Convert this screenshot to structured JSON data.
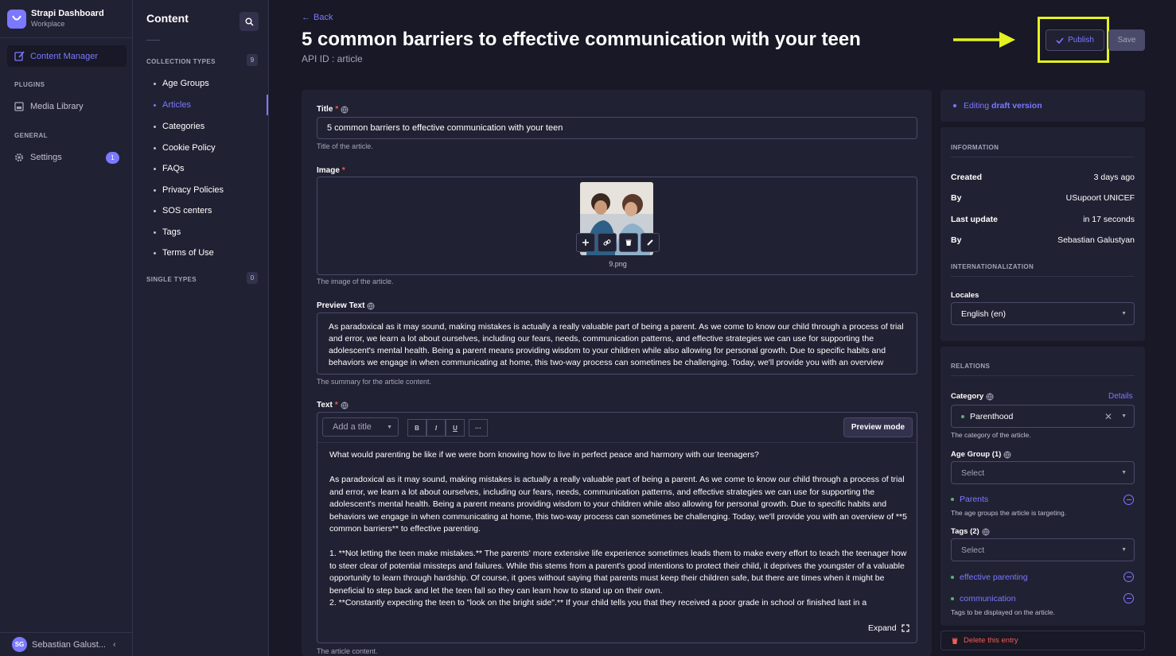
{
  "brand": {
    "name": "Strapi Dashboard",
    "sub": "Workplace"
  },
  "nav": {
    "content_manager": "Content Manager",
    "plugins_label": "PLUGINS",
    "media_library": "Media Library",
    "general_label": "GENERAL",
    "settings": "Settings",
    "settings_badge": "1",
    "user_initials": "SG",
    "user_name": "Sebastian Galust..."
  },
  "subnav": {
    "title": "Content",
    "collection_label": "COLLECTION TYPES",
    "collection_count": "9",
    "items": [
      "Age Groups",
      "Articles",
      "Categories",
      "Cookie Policy",
      "FAQs",
      "Privacy Policies",
      "SOS centers",
      "Tags",
      "Terms of Use"
    ],
    "active_item": "Articles",
    "single_label": "SINGLE TYPES",
    "single_count": "0"
  },
  "header": {
    "back": "Back",
    "title": "5 common barriers to effective communication with your teen",
    "api_id": "API ID : article",
    "publish": "Publish",
    "save": "Save"
  },
  "form": {
    "title_label": "Title",
    "title_value": "5 common barriers to effective communication with your teen",
    "title_hint": "Title of the article.",
    "image_label": "Image",
    "image_name": "9.png",
    "image_hint": "The image of the article.",
    "preview_label": "Preview Text",
    "preview_value": "As paradoxical as it may sound, making mistakes is actually a really valuable part of being a parent. As we come to know our child through a process of trial and error, we learn a lot about ourselves, including our fears, needs, communication patterns, and effective strategies we can use for supporting the adolescent's mental health. Being a parent means providing wisdom to your children while also allowing for personal growth. Due to specific habits and behaviors we engage in when communicating at home, this two-way process can sometimes be challenging. Today, we'll provide you with an overview",
    "preview_hint": "The summary for the article content.",
    "text_label": "Text",
    "toolbar_select": "Add a title",
    "toolbar_bold": "B",
    "toolbar_italic": "I",
    "toolbar_underline": "U",
    "toolbar_more": "···",
    "preview_mode": "Preview mode",
    "text_p1": "What would parenting be like if we were born knowing how to live in perfect peace and harmony with our teenagers?",
    "text_p2": "As paradoxical as it may sound, making mistakes is actually a really valuable part of being a parent. As we come to know our child through a process of trial and error, we learn a lot about ourselves, including our fears, needs, communication patterns, and effective strategies we can use for supporting the adolescent's mental health. Being a parent means providing wisdom to your children while also allowing for personal growth. Due to specific habits and behaviors we engage in when communicating at home, this two-way process can sometimes be challenging. Today, we'll provide you with an overview of **5 common barriers** to effective parenting.",
    "text_p3": "1. **Not letting the teen make mistakes.** The parents' more extensive life experience sometimes leads them to make every effort to teach the teenager how to steer clear of potential missteps and failures. While this stems from a parent's good intentions to protect their child, it deprives the youngster of a valuable opportunity to learn through hardship. Of course, it goes without saying that parents must keep their children safe, but there are times when it might be beneficial to step back and let the teen fall so they can learn how to stand up on their own.",
    "text_p4": "2. **Constantly expecting the teen to \"look on the bright side\".** If your child tells you that they received a poor grade in school or finished last in a",
    "expand": "Expand",
    "text_hint": "The article content."
  },
  "side": {
    "editing_prefix": "Editing",
    "editing_bold": "draft version",
    "info_label": "INFORMATION",
    "info": [
      {
        "k": "Created",
        "v": "3 days ago"
      },
      {
        "k": "By",
        "v": "USupoort UNICEF"
      },
      {
        "k": "Last update",
        "v": "in 17 seconds"
      },
      {
        "k": "By",
        "v": "Sebastian Galustyan"
      }
    ],
    "i18n_label": "INTERNATIONALIZATION",
    "locales_label": "Locales",
    "locale_value": "English (en)",
    "relations_label": "RELATIONS",
    "category_label": "Category",
    "details": "Details",
    "category_value": "Parenthood",
    "category_hint": "The category of the article.",
    "age_label": "Age Group (1)",
    "age_placeholder": "Select",
    "age_item": "Parents",
    "age_hint": "The age groups the article is targeting.",
    "tags_label": "Tags (2)",
    "tags_placeholder": "Select",
    "tag1": "effective parenting",
    "tag2": "communication",
    "tags_hint": "Tags to be displayed on the article.",
    "delete": "Delete this entry"
  },
  "colors": {
    "accent": "#7b79ff",
    "highlight": "#e4f21f",
    "danger": "#ee5e52",
    "success": "#5cb176",
    "bg": "#181826",
    "panel": "#212134"
  }
}
